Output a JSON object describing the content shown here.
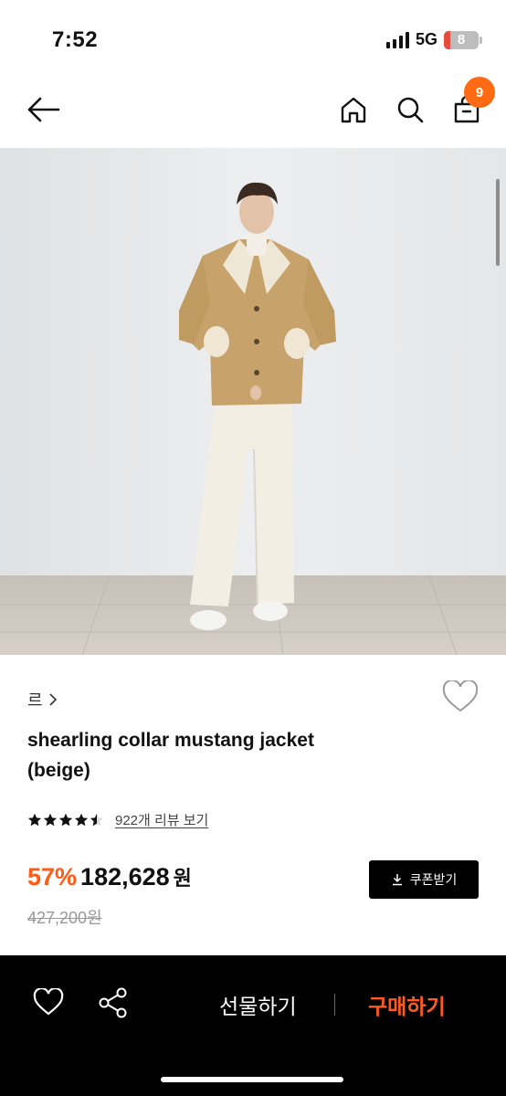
{
  "status_bar": {
    "time": "7:52",
    "network": "5G",
    "battery": "8"
  },
  "nav": {
    "cart_count": "9"
  },
  "product": {
    "brand": "르",
    "title_line1": "shearling collar mustang jacket",
    "title_line2": "(beige)",
    "rating_value": 4.5,
    "review_link": "922개 리뷰 보기",
    "discount": "57%",
    "price": "182,628",
    "price_unit": "원",
    "original_price": "427,200원",
    "coupon_label": "쿠폰받기"
  },
  "bottom_bar": {
    "gift_label": "선물하기",
    "buy_label": "구매하기"
  },
  "colors": {
    "accent": "#ff5a16",
    "badge": "#ff6a13",
    "bottom_bar": "#000000"
  }
}
